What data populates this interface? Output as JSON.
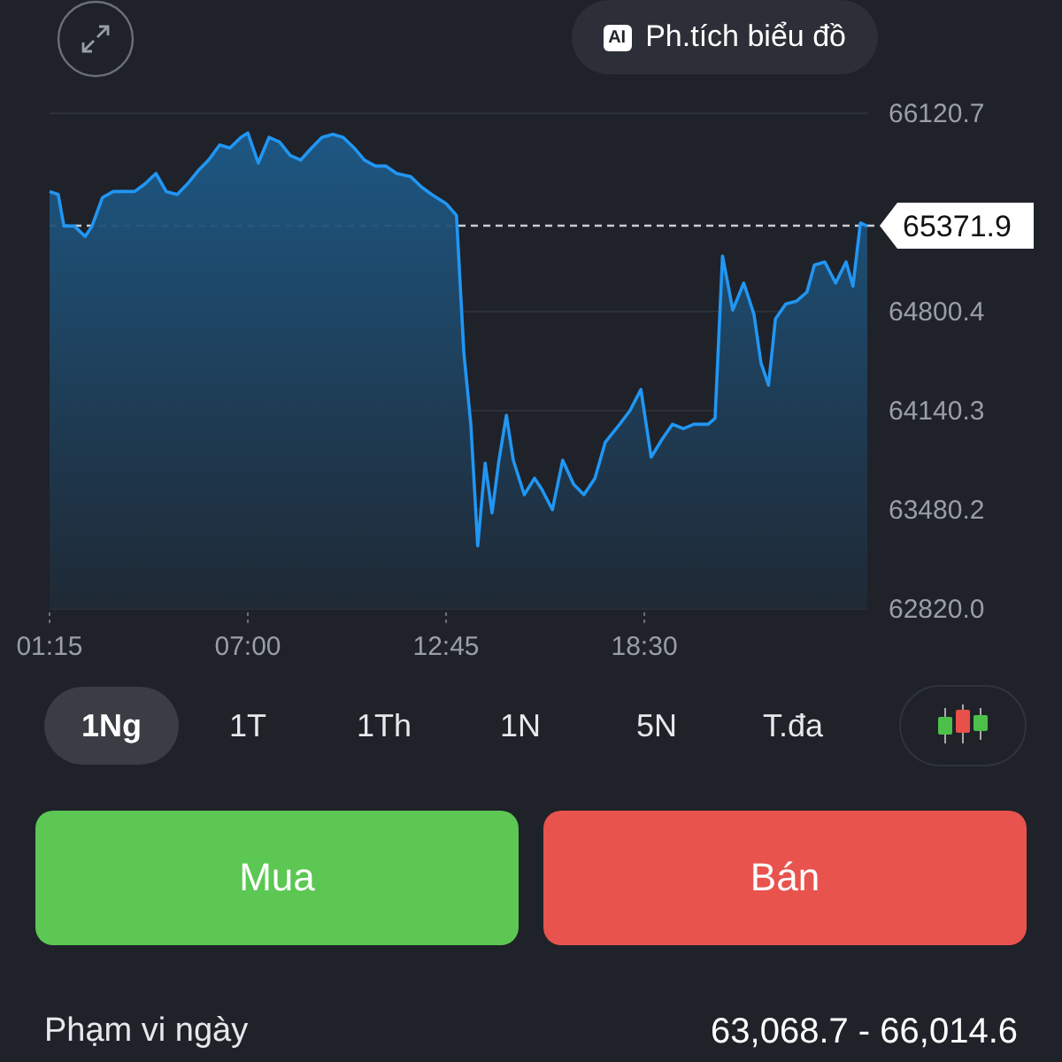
{
  "ai_button": {
    "badge": "AI",
    "label": "Ph.tích biểu đồ"
  },
  "chart_data": {
    "type": "area",
    "x": [
      75,
      90,
      100,
      118,
      137,
      149,
      167,
      186,
      204,
      223,
      241,
      260,
      278,
      297,
      315,
      334,
      352,
      371,
      389,
      408,
      420,
      438,
      457,
      475,
      494,
      512,
      531,
      549,
      568,
      586,
      605,
      623,
      642,
      660,
      679,
      703,
      722,
      740,
      765,
      783,
      796,
      808,
      820,
      833,
      845,
      857,
      870,
      882,
      901,
      919,
      931,
      950,
      968,
      987,
      1005,
      1024,
      1042,
      1067,
      1085,
      1104,
      1122,
      1141,
      1159,
      1178,
      1196,
      1221,
      1233,
      1246,
      1264,
      1283,
      1301,
      1313,
      1326,
      1338,
      1356,
      1375,
      1393,
      1406,
      1424,
      1443,
      1461,
      1473,
      1486,
      1498
    ],
    "series": [
      {
        "color": "#2196f3",
        "values": [
          65600,
          65580,
          65370,
          65370,
          65300,
          65370,
          65560,
          65600,
          65600,
          65600,
          65650,
          65720,
          65600,
          65580,
          65650,
          65740,
          65810,
          65910,
          65890,
          65960,
          65990,
          65790,
          65960,
          65930,
          65840,
          65810,
          65890,
          65960,
          65980,
          65960,
          65890,
          65810,
          65770,
          65770,
          65720,
          65700,
          65630,
          65580,
          65520,
          65440,
          64520,
          64050,
          63240,
          63790,
          63460,
          63810,
          64110,
          63810,
          63580,
          63690,
          63620,
          63480,
          63810,
          63650,
          63580,
          63690,
          63930,
          64050,
          64140,
          64280,
          63830,
          63950,
          64050,
          64020,
          64050,
          64050,
          64090,
          65170,
          64810,
          64990,
          64780,
          64460,
          64310,
          64750,
          64850,
          64870,
          64930,
          65110,
          65130,
          64990,
          65130,
          64970,
          65390,
          65370
        ]
      }
    ],
    "grid": true,
    "xlim": [
      75,
      1498
    ],
    "ylim": [
      62820,
      66120.7
    ],
    "xticks": [
      {
        "value": 75,
        "label": "01:15"
      },
      {
        "value": 420,
        "label": "07:00"
      },
      {
        "value": 765,
        "label": "12:45"
      },
      {
        "value": 1110,
        "label": "18:30"
      }
    ],
    "yticks": [
      {
        "value": 66120.7,
        "label": "66120.7"
      },
      {
        "value": 64800.4,
        "label": "64800.4"
      },
      {
        "value": 64140.3,
        "label": "64140.3"
      },
      {
        "value": 63480.2,
        "label": "63480.2"
      },
      {
        "value": 62820,
        "label": "62820.0"
      }
    ],
    "ref_lines": [
      {
        "axis": "y",
        "value": 65371.9,
        "label": "65371.9"
      }
    ]
  },
  "periods": [
    {
      "label": "1Ng",
      "selected": true
    },
    {
      "label": "1T",
      "selected": false
    },
    {
      "label": "1Th",
      "selected": false
    },
    {
      "label": "1N",
      "selected": false
    },
    {
      "label": "5N",
      "selected": false
    },
    {
      "label": "T.đa",
      "selected": false
    }
  ],
  "buttons": [
    {
      "kind": "buy",
      "label": "Mua"
    },
    {
      "kind": "sell",
      "label": "Bán"
    }
  ],
  "day_range": {
    "label": "Phạm vi ngày",
    "value": "63,068.7 - 66,014.6"
  }
}
